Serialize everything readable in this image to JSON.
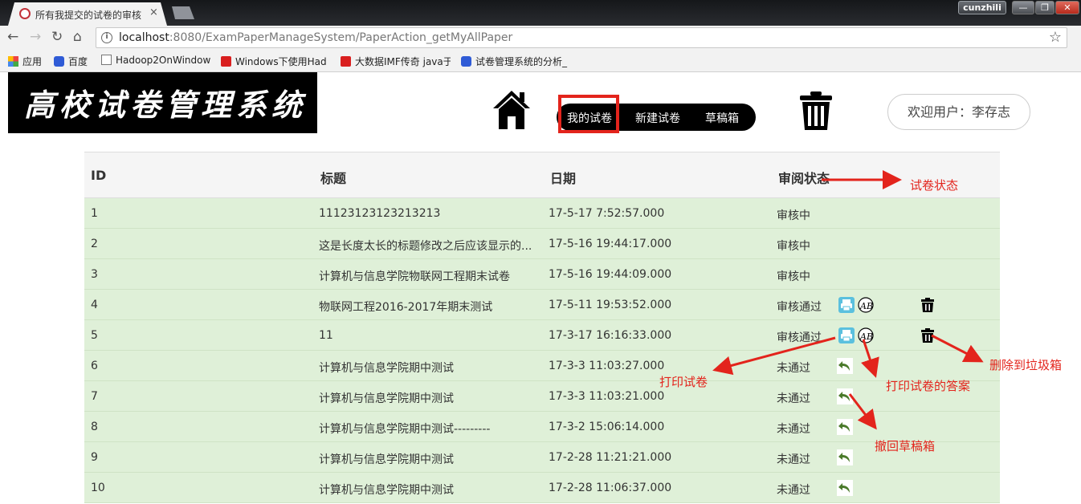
{
  "browser": {
    "tab_title": "所有我提交的试卷的审核",
    "tab_close": "×",
    "user_chip": "cunzhili",
    "url_host": "localhost",
    "url_path": ":8080/ExamPaperManageSystem/PaperAction_getMyAllPaper",
    "bookmarks": [
      {
        "label": "应用",
        "icon": "apps-grid-icon"
      },
      {
        "label": "百度",
        "icon": "baidu-paw-icon"
      },
      {
        "label": "Hadoop2OnWindow",
        "icon": "page-icon"
      },
      {
        "label": "Windows下使用Had",
        "icon": "csdn-icon"
      },
      {
        "label": "大数据IMF传奇 java于",
        "icon": "csdn-icon"
      },
      {
        "label": "试卷管理系统的分析_",
        "icon": "baidu-paw-icon"
      }
    ]
  },
  "header": {
    "logo_text": "高校试卷管理系统",
    "nav": [
      "我的试卷",
      "新建试卷",
      "草稿箱"
    ],
    "welcome": "欢迎用户：李存志"
  },
  "table": {
    "headers": [
      "ID",
      "标题",
      "日期",
      "审阅状态"
    ],
    "rows": [
      {
        "id": "1",
        "title": "11123123123213213",
        "date": "17-5-17 7:52:57.000",
        "status": "审核中",
        "actions": []
      },
      {
        "id": "2",
        "title": "这是长度太长的标题修改之后应该显示的...",
        "date": "17-5-16 19:44:17.000",
        "status": "审核中",
        "actions": []
      },
      {
        "id": "3",
        "title": "计算机与信息学院物联网工程期末试卷",
        "date": "17-5-16 19:44:09.000",
        "status": "审核中",
        "actions": []
      },
      {
        "id": "4",
        "title": "物联网工程2016-2017年期末测试",
        "date": "17-5-11 19:53:52.000",
        "status": "审核通过",
        "actions": [
          "print",
          "answer",
          "delete"
        ]
      },
      {
        "id": "5",
        "title": "11",
        "date": "17-3-17 16:16:33.000",
        "status": "审核通过",
        "actions": [
          "print",
          "answer",
          "delete"
        ]
      },
      {
        "id": "6",
        "title": "计算机与信息学院期中测试",
        "date": "17-3-3 11:03:27.000",
        "status": "未通过",
        "actions": [
          "undo"
        ]
      },
      {
        "id": "7",
        "title": "计算机与信息学院期中测试",
        "date": "17-3-3 11:03:21.000",
        "status": "未通过",
        "actions": [
          "undo"
        ]
      },
      {
        "id": "8",
        "title": "计算机与信息学院期中测试---------",
        "date": "17-3-2 15:06:14.000",
        "status": "未通过",
        "actions": [
          "undo"
        ]
      },
      {
        "id": "9",
        "title": "计算机与信息学院期中测试",
        "date": "17-2-28 11:21:21.000",
        "status": "未通过",
        "actions": [
          "undo"
        ]
      },
      {
        "id": "10",
        "title": "计算机与信息学院期中测试",
        "date": "17-2-28 11:06:37.000",
        "status": "未通过",
        "actions": [
          "undo"
        ]
      }
    ]
  },
  "annotations": {
    "status": "试卷状态",
    "print": "打印试卷",
    "answer": "打印试卷的答案",
    "delete": "删除到垃圾箱",
    "undo": "撤回草稿箱"
  },
  "colors": {
    "row_bg": "#dff0d8",
    "annotation": "#e3241c",
    "print_icon": "#5bc0de"
  }
}
